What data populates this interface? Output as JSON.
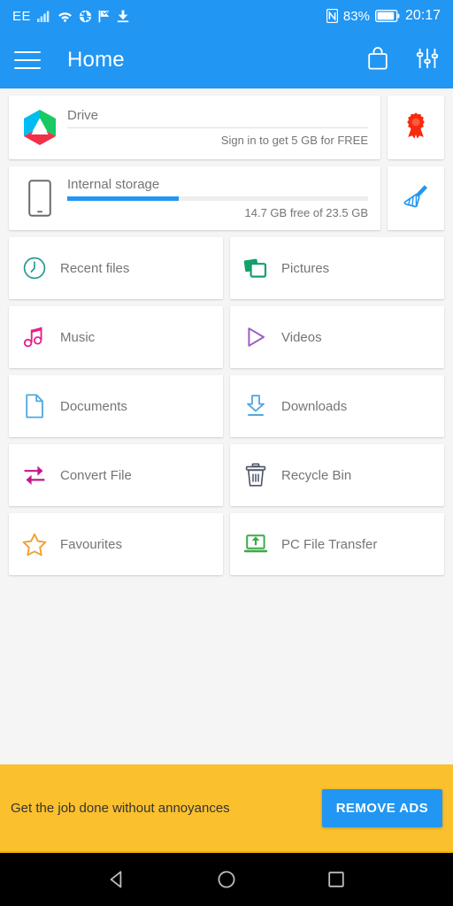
{
  "status_bar": {
    "carrier": "EE",
    "battery_percent": "83%",
    "time": "20:17",
    "icons": [
      "signal-bars-icon",
      "wifi-icon",
      "globe-icon",
      "flag-icon",
      "download-icon",
      "nfc-icon",
      "battery-icon"
    ],
    "background_color": "#2196f3"
  },
  "app_bar": {
    "title": "Home",
    "menu_icon": "hamburger-menu-icon",
    "shop_icon": "shopping-bag-icon",
    "settings_icon": "sliders-settings-icon",
    "background_color": "#2196f3"
  },
  "storage": {
    "drive": {
      "label": "Drive",
      "sub": "Sign in to get 5 GB for FREE",
      "icon": "drive-hexagon-logo",
      "badge_icon": "award-ribbon-icon"
    },
    "internal": {
      "label": "Internal storage",
      "sub": "14.7 GB free of 23.5 GB",
      "icon": "phone-icon",
      "progress_percent": 37,
      "progress_color": "#2196f3",
      "cleaner_icon": "broom-icon"
    }
  },
  "grid": {
    "tiles": [
      {
        "label": "Recent files",
        "icon": "clock-icon",
        "color": "#1e9688"
      },
      {
        "label": "Pictures",
        "icon": "photos-stack-icon",
        "color": "#13a06a"
      },
      {
        "label": "Music",
        "icon": "music-note-icon",
        "color": "#e91e8c"
      },
      {
        "label": "Videos",
        "icon": "play-triangle-icon",
        "color": "#9c5fc4"
      },
      {
        "label": "Documents",
        "icon": "document-page-icon",
        "color": "#4fa8e0"
      },
      {
        "label": "Downloads",
        "icon": "download-arrow-icon",
        "color": "#4fa8e0"
      },
      {
        "label": "Convert File",
        "icon": "convert-arrows-icon",
        "color": "#c2188d"
      },
      {
        "label": "Recycle Bin",
        "icon": "trash-bin-icon",
        "color": "#4b5566"
      },
      {
        "label": "Favourites",
        "icon": "star-outline-icon",
        "color": "#f0a030"
      },
      {
        "label": "PC File Transfer",
        "icon": "laptop-upload-icon",
        "color": "#3faa49"
      }
    ]
  },
  "ad_banner": {
    "text": "Get the job done without annoyances",
    "button_label": "REMOVE ADS",
    "background_color": "#fbc02d",
    "button_color": "#2196f3"
  },
  "nav_bar": {
    "back_icon": "back-triangle-icon",
    "home_icon": "home-circle-icon",
    "recents_icon": "recents-square-icon"
  }
}
